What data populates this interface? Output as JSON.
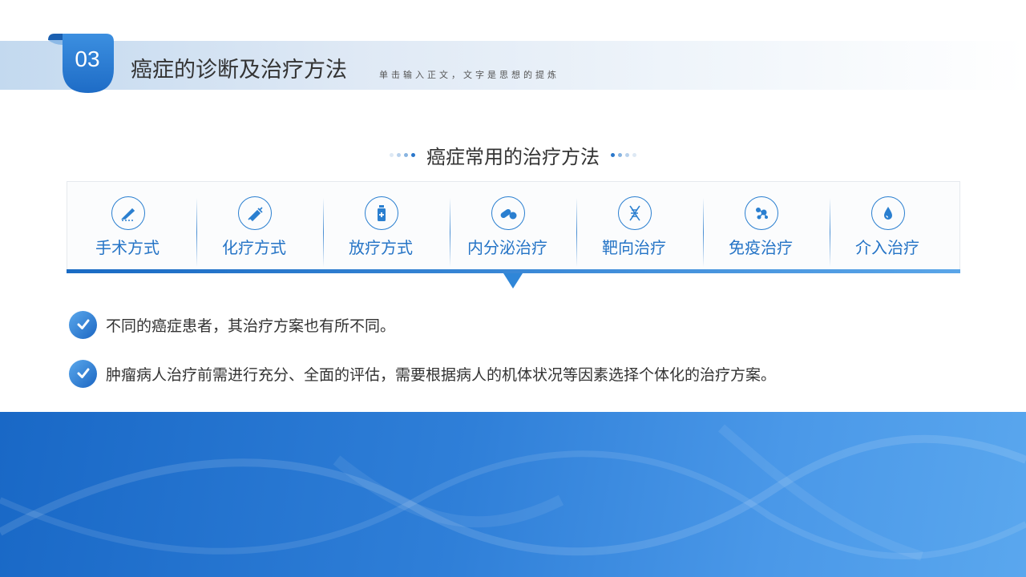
{
  "header": {
    "number": "03",
    "title": "癌症的诊断及治疗方法",
    "subtitle": "单击输入正文，文字是思想的提炼"
  },
  "section": {
    "title": "癌症常用的治疗方法"
  },
  "methods": [
    {
      "label": "手术方式",
      "icon": "scalpel-icon"
    },
    {
      "label": "化疗方式",
      "icon": "syringe-icon"
    },
    {
      "label": "放疗方式",
      "icon": "medicine-bottle-icon"
    },
    {
      "label": "内分泌治疗",
      "icon": "pills-icon"
    },
    {
      "label": "靶向治疗",
      "icon": "dna-icon"
    },
    {
      "label": "免疫治疗",
      "icon": "molecule-icon"
    },
    {
      "label": "介入治疗",
      "icon": "droplet-icon"
    }
  ],
  "bullets": [
    "不同的癌症患者，其治疗方案也有所不同。",
    "肿瘤病人治疗前需进行充分、全面的评估，需要根据病人的机体状况等因素选择个体化的治疗方案。"
  ],
  "colors": {
    "accent": "#2574c6",
    "accent_light": "#5aa5e8",
    "text": "#333333",
    "banner_start": "#1968c6",
    "banner_end": "#5aa7ee"
  }
}
